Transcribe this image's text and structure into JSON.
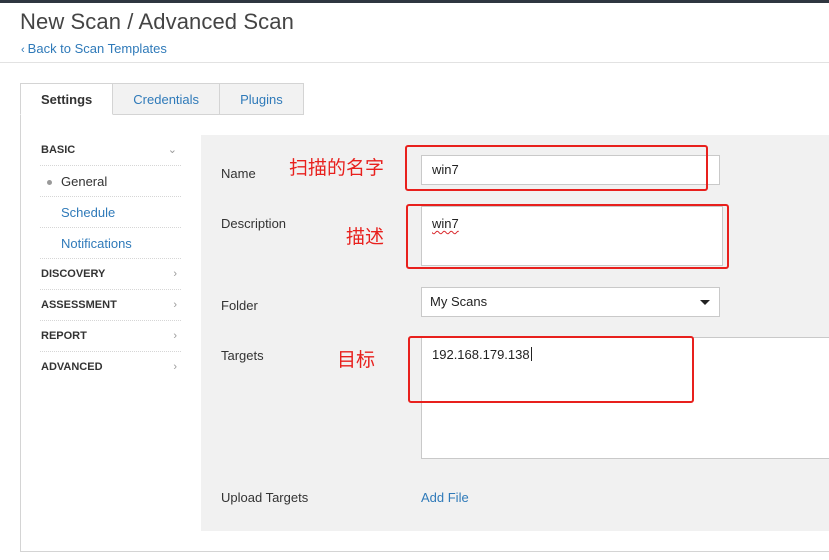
{
  "header": {
    "title": "New Scan / Advanced Scan",
    "back_link": "Back to Scan Templates"
  },
  "tabs": [
    {
      "label": "Settings",
      "active": true
    },
    {
      "label": "Credentials",
      "active": false
    },
    {
      "label": "Plugins",
      "active": false
    }
  ],
  "sidebar": {
    "sections": [
      {
        "label": "BASIC",
        "expanded": true,
        "items": [
          {
            "label": "General",
            "current": true
          },
          {
            "label": "Schedule",
            "current": false
          },
          {
            "label": "Notifications",
            "current": false
          }
        ]
      },
      {
        "label": "DISCOVERY",
        "expanded": false
      },
      {
        "label": "ASSESSMENT",
        "expanded": false
      },
      {
        "label": "REPORT",
        "expanded": false
      },
      {
        "label": "ADVANCED",
        "expanded": false
      }
    ]
  },
  "form": {
    "name_label": "Name",
    "name_value": "win7",
    "description_label": "Description",
    "description_value": "win7",
    "folder_label": "Folder",
    "folder_value": "My Scans",
    "targets_label": "Targets",
    "targets_value": "192.168.179.138",
    "upload_label": "Upload Targets",
    "add_file": "Add File"
  },
  "annotations": {
    "name_note": "扫描的名字",
    "description_note": "描述",
    "targets_note": "目标"
  },
  "colors": {
    "link": "#2f7ab9",
    "annotation": "#e8201d",
    "form_background": "#f1f1f1"
  }
}
